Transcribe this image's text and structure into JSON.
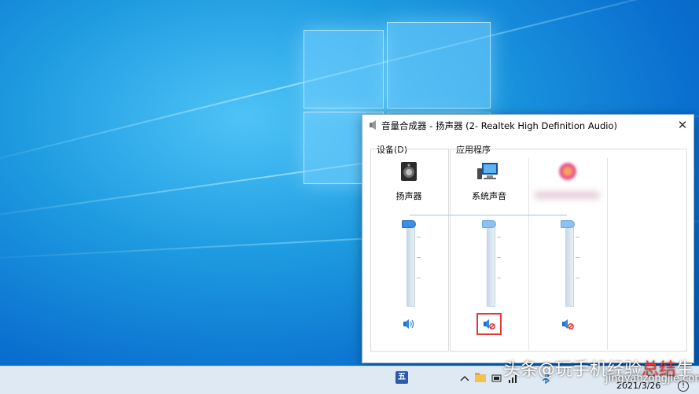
{
  "window": {
    "title": "音量合成器 - 扬声器 (2- Realtek High Definition Audio)",
    "close_glyph": "✕"
  },
  "groups": {
    "devices_label": "设备(D)",
    "apps_label": "应用程序"
  },
  "channels": [
    {
      "name": "扬声器",
      "icon": "speaker-device-icon",
      "volume_percent": 100,
      "muted": false
    },
    {
      "name": "系统声音",
      "icon": "system-sounds-icon",
      "volume_percent": 100,
      "muted": true
    },
    {
      "name": "",
      "icon": "app-icon-blurred",
      "volume_percent": 100,
      "muted": true
    }
  ],
  "taskbar": {
    "ime_label": "五",
    "clock_date": "2021/3/26"
  },
  "watermark": {
    "line1_a": "头条@玩手机",
    "line1_b": "经验",
    "line1_c": "总结",
    "line1_d": "生",
    "line2": "jingyanzongjie.com"
  },
  "colors": {
    "accent": "#3a8ee6",
    "highlight_box": "#e53935"
  }
}
